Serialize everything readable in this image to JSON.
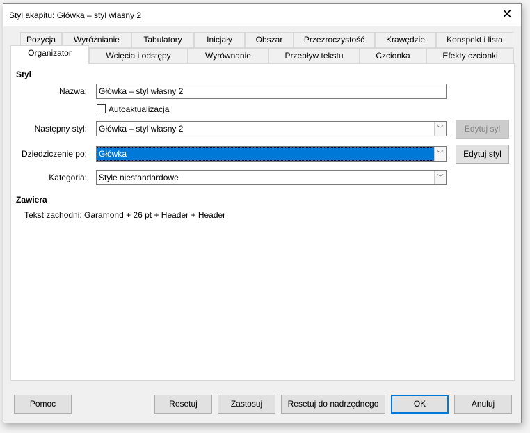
{
  "window": {
    "title": "Styl akapitu: Główka – styl własny 2",
    "close_icon": "close-icon"
  },
  "tabs_row1": [
    "Pozycja",
    "Wyróżnianie",
    "Tabulatory",
    "Inicjały",
    "Obszar",
    "Przezroczystość",
    "Krawędzie",
    "Konspekt i lista"
  ],
  "tabs_row2": [
    "Organizator",
    "Wcięcia i odstępy",
    "Wyrównanie",
    "Przepływ tekstu",
    "Czcionka",
    "Efekty czcionki"
  ],
  "active_tab": "Organizator",
  "style": {
    "heading": "Styl",
    "name_label": "Nazwa:",
    "name_value": "Główka – styl własny 2",
    "autoupdate_label": "Autoaktualizacja",
    "autoupdate_checked": false,
    "next_label": "Następny styl:",
    "next_value": "Główka – styl własny 2",
    "next_edit": "Edytuj syl",
    "inherit_label": "Dziedziczenie po:",
    "inherit_value": "Główka",
    "inherit_edit": "Edytuj styl",
    "category_label": "Kategoria:",
    "category_value": "Style niestandardowe"
  },
  "contains": {
    "heading": "Zawiera",
    "text": "Tekst zachodni: Garamond + 26 pt + Header + Header"
  },
  "buttons": {
    "help": "Pomoc",
    "reset": "Resetuj",
    "apply": "Zastosuj",
    "reset_parent": "Resetuj do nadrzędnego",
    "ok": "OK",
    "cancel": "Anuluj"
  },
  "colors": {
    "accent": "#0078d7"
  }
}
